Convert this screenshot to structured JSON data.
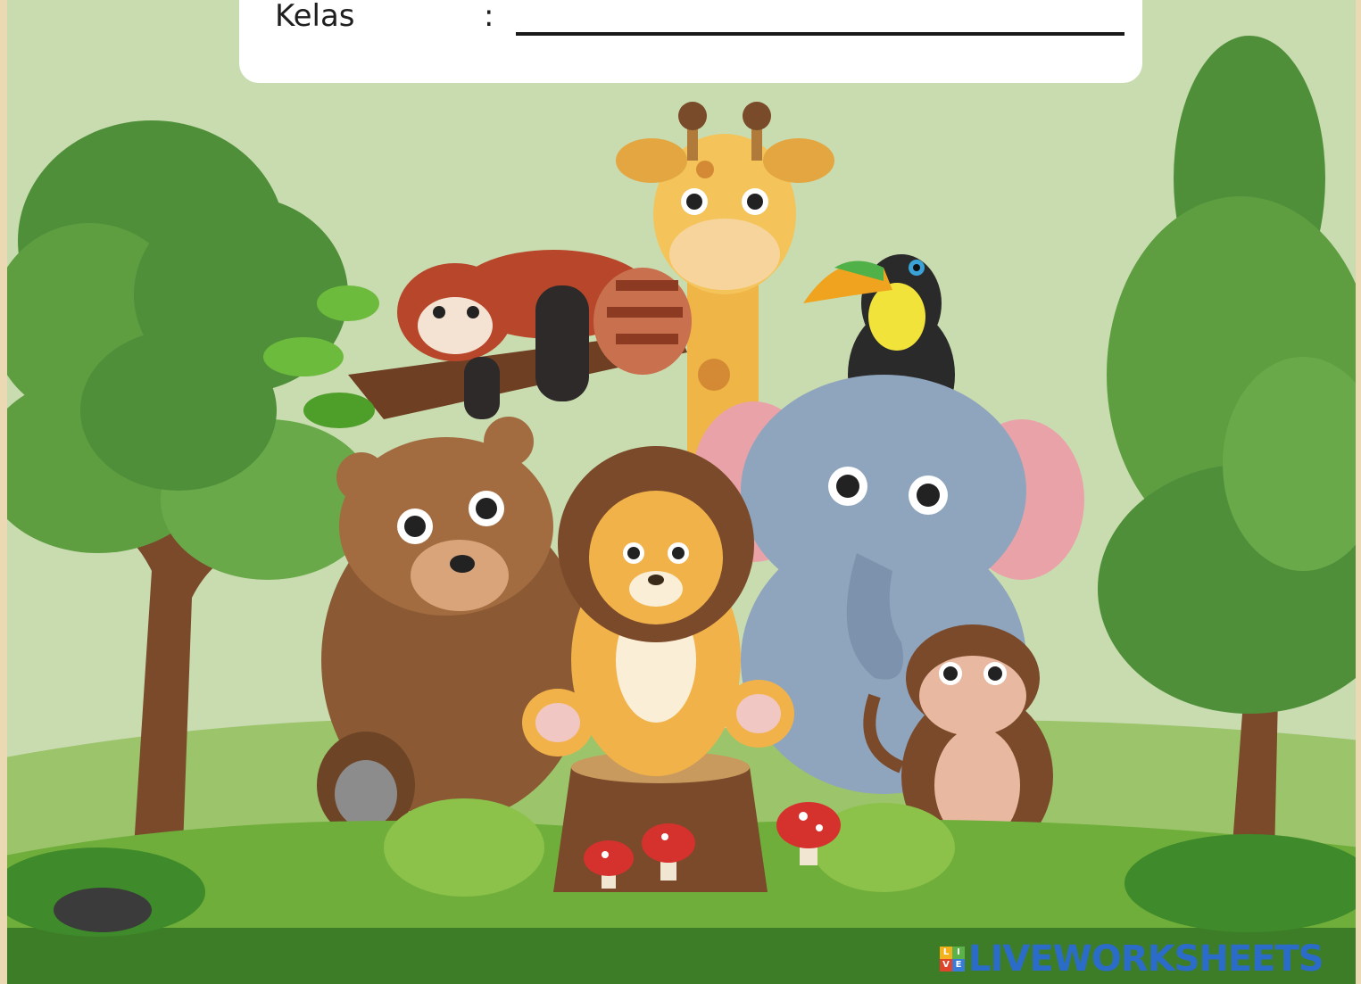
{
  "form": {
    "kelas_label": "Kelas",
    "colon": ":",
    "kelas_value": ""
  },
  "illustration": {
    "animals": [
      "red-panda",
      "giraffe",
      "toucan",
      "bear",
      "lion",
      "elephant",
      "monkey"
    ]
  },
  "brand": {
    "name": "LIVEWORKSHEETS",
    "logo_letters": [
      "L",
      "I",
      "V",
      "E"
    ],
    "colors": {
      "text": "#2b6cc9",
      "logo": [
        "#f3b21b",
        "#5bb249",
        "#e0452b",
        "#3a7bd5"
      ]
    }
  },
  "colors": {
    "sky": "#c9dcb0",
    "grass": "#6fae3b",
    "grass_dark": "#3e7d28"
  }
}
